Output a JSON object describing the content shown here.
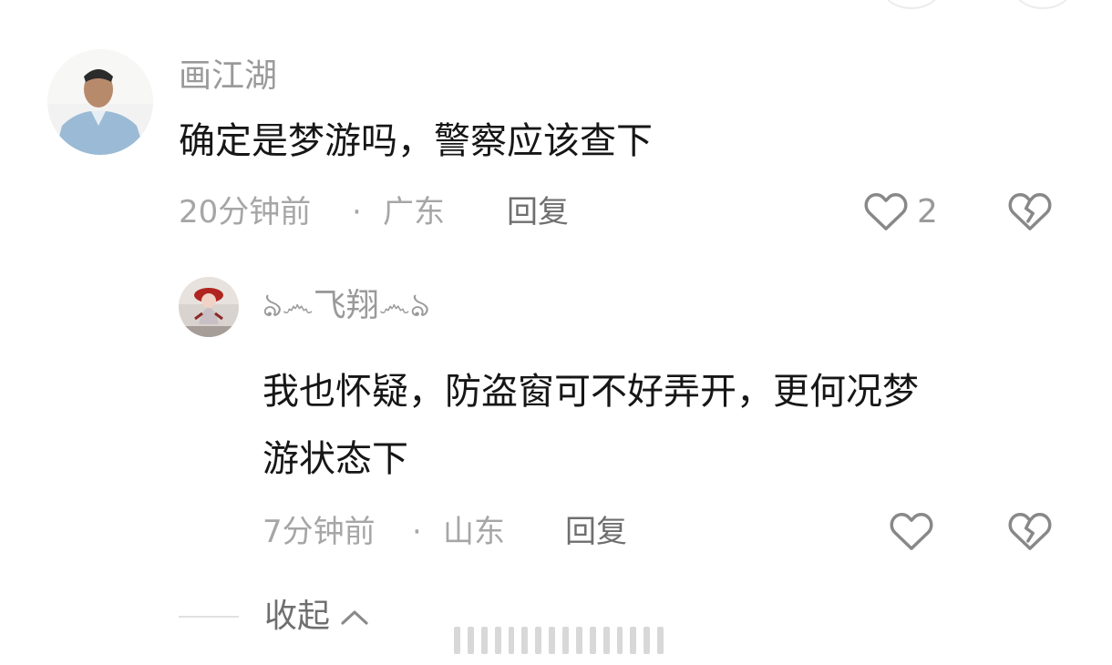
{
  "comment": {
    "author": "画江湖",
    "text": "确定是梦游吗，警察应该查下",
    "time": "20分钟前",
    "separator": "·",
    "location": "广东",
    "reply_label": "回复",
    "like_count": "2",
    "like_icon": "heart-outline-icon",
    "dislike_icon": "broken-heart-icon"
  },
  "reply": {
    "author": "ঌ෴飞翔෴ঌ",
    "text_line1": "我也怀疑，防盗窗可不好弄开，更何况梦",
    "text_line2": "游状态下",
    "time": "7分钟前",
    "separator": "·",
    "location": "山东",
    "reply_label": "回复",
    "like_icon": "heart-outline-icon",
    "dislike_icon": "broken-heart-icon"
  },
  "collapse": {
    "label": "收起",
    "icon": "chevron-up-icon"
  },
  "colors": {
    "text_primary": "#161616",
    "text_secondary": "#9a9a9a",
    "reply_text": "#6f6f6f"
  }
}
